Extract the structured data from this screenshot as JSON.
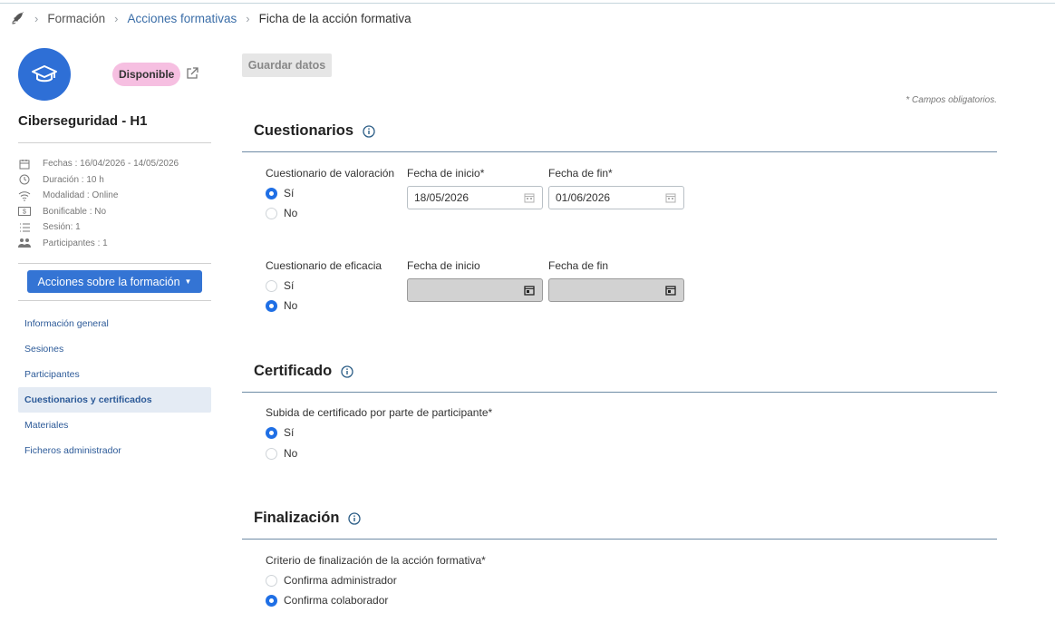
{
  "breadcrumb": {
    "item1": "Formación",
    "item2": "Acciones formativas",
    "current": "Ficha de la acción formativa"
  },
  "course": {
    "status": "Disponible",
    "title": "Ciberseguridad - H1",
    "meta": {
      "dates": "Fechas : 16/04/2026 - 14/05/2026",
      "duration": "Duración : 10 h",
      "modality": "Modalidad : Online",
      "bonus": "Bonificable : No",
      "session": "Sesión: 1",
      "participants": "Participantes : 1"
    },
    "actions_button": "Acciones sobre la formación"
  },
  "nav": {
    "general": "Información general",
    "sessions": "Sesiones",
    "participants": "Participantes",
    "questionnaires": "Cuestionarios y certificados",
    "materials": "Materiales",
    "admin_files": "Ficheros administrador"
  },
  "toolbar": {
    "save_label": "Guardar datos",
    "required_note": "* Campos obligatorios."
  },
  "cuestionarios": {
    "title": "Cuestionarios",
    "valoracion": {
      "label": "Cuestionario de valoración",
      "yes": "Sí",
      "no": "No",
      "selected": "Sí",
      "start_label": "Fecha de inicio*",
      "start_value": "18/05/2026",
      "end_label": "Fecha de fin*",
      "end_value": "01/06/2026"
    },
    "eficacia": {
      "label": "Cuestionario de eficacia",
      "yes": "Sí",
      "no": "No",
      "selected": "No",
      "start_label": "Fecha de inicio",
      "start_value": "",
      "end_label": "Fecha de fin",
      "end_value": ""
    }
  },
  "certificado": {
    "title": "Certificado",
    "upload_label": "Subida de certificado por parte de participante*",
    "yes": "Sí",
    "no": "No",
    "selected": "Sí"
  },
  "finalizacion": {
    "title": "Finalización",
    "criterion_label": "Criterio de finalización de la acción formativa*",
    "option_admin": "Confirma administrador",
    "option_colab": "Confirma colaborador",
    "selected": "Confirma colaborador"
  },
  "colors": {
    "primary": "#3474d4",
    "radio": "#1f6fe5",
    "badge": "#f6bfe1",
    "nav_link": "#2c5a98",
    "section_line": "#6e8ba5"
  }
}
